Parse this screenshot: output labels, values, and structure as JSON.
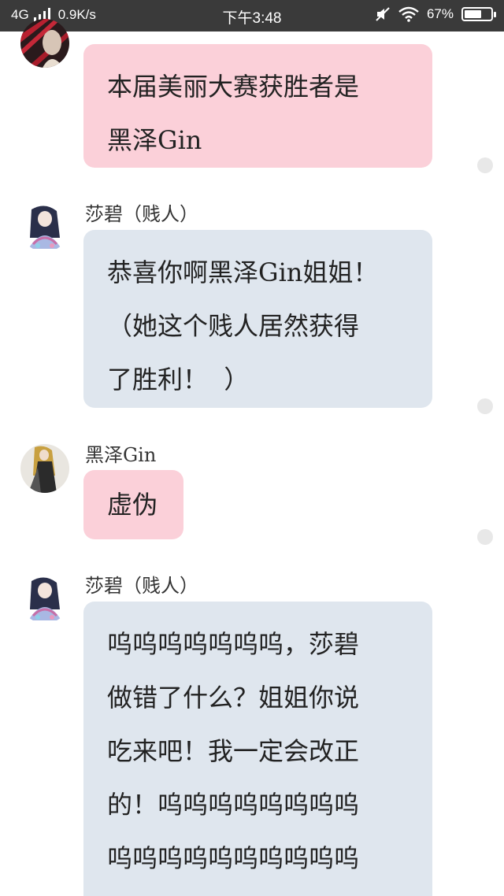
{
  "status_bar": {
    "network": "4G",
    "speed": "0.9K/s",
    "time": "下午3:48",
    "battery_percent": "67%",
    "battery_level": 0.67,
    "icons": [
      "signal-icon",
      "mute-icon",
      "wifi-icon",
      "battery-icon"
    ]
  },
  "messages": [
    {
      "sender": "",
      "text": "本届美丽大赛获胜者是\n黑泽Gin",
      "bubble_color": "#fbd0d9"
    },
    {
      "sender": "莎碧（贱人）",
      "text": "恭喜你啊黑泽Gin姐姐！\n（她这个贱人居然获得\n了胜利！  ）",
      "bubble_color": "#dfe6ee"
    },
    {
      "sender": "黑泽Gin",
      "text": "虚伪",
      "bubble_color": "#fbd0d9"
    },
    {
      "sender": "莎碧（贱人）",
      "text": "呜呜呜呜呜呜呜，莎碧\n做错了什么？姐姐你说\n吃来吧！我一定会改正\n的！呜呜呜呜呜呜呜呜\n呜呜呜呜呜呜呜呜呜呜\n！",
      "bubble_color": "#dfe6ee"
    }
  ]
}
